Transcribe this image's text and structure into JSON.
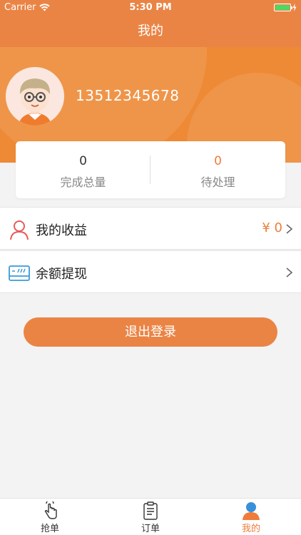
{
  "status_bar": {
    "carrier": "Carrier",
    "time": "5:30 PM"
  },
  "nav": {
    "title": "我的"
  },
  "profile": {
    "phone": "13512345678"
  },
  "stats": [
    {
      "value": "0",
      "label": "完成总量"
    },
    {
      "value": "0",
      "label": "待处理"
    }
  ],
  "menu": [
    {
      "label": "我的收益",
      "value": "¥ 0",
      "icon": "user-icon"
    },
    {
      "label": "余额提现",
      "value": "",
      "icon": "card-icon"
    }
  ],
  "logout": {
    "label": "退出登录"
  },
  "tabs": [
    {
      "label": "抢单",
      "icon": "tap-hand-icon"
    },
    {
      "label": "订单",
      "icon": "clipboard-icon"
    },
    {
      "label": "我的",
      "icon": "profile-icon"
    }
  ],
  "colors": {
    "brand": "#ea8445",
    "accent": "#ee7d3b"
  }
}
